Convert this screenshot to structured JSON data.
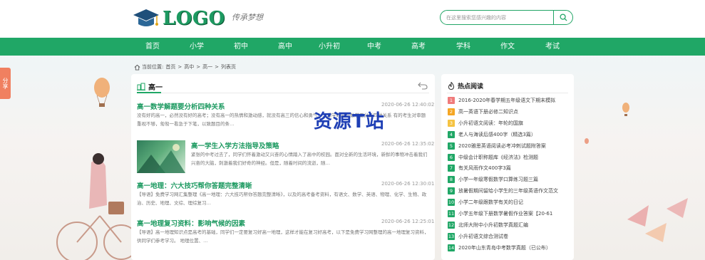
{
  "header": {
    "logo_text": "LOGO",
    "slogan": "传承梦想",
    "search_placeholder": "在这里搜索您感兴趣的内容"
  },
  "nav": {
    "items": [
      "首页",
      "小学",
      "初中",
      "高中",
      "小升初",
      "中考",
      "高考",
      "学科",
      "作文",
      "考试"
    ]
  },
  "share_tab": "分享",
  "breadcrumb": {
    "prefix": "当前位置:",
    "items": [
      "首页",
      ">",
      "高中",
      ">",
      "高一",
      ">",
      "列表页"
    ]
  },
  "main": {
    "section_title": "高一",
    "articles": [
      {
        "title": "高一数学解题要分析四种关系",
        "date": "2020-06-26 12:40:02",
        "desc": "没有好的高一，必然没有好的高考；没有高一的热情和激动感，就没有高三的信心和勇气……想学好高一数学要分析四种关系    有的考生对审题重视不够，匆匆一看急于下笔，以致题目的条…"
      },
      {
        "title": "高一学生入学方法指导及策略",
        "date": "2020-06-26 12:35:02",
        "desc": "紧张的中考过去了，同学们怀着激动又兴奋的心情踏入了高中的校园。面对全新的生活环境，新鲜的事物冲击着我们兴奋的大脑，刺激着我们好奇的神经。但是，随着时间的流逝，随…"
      },
      {
        "title": "高一地理：六大技巧帮你答题完整清晰",
        "date": "2020-06-26 12:30:01",
        "desc": "【导语】免费学习网汇集整理《高一地理：六大技巧帮你答题完整清晰》，以及的高考备考资料，有语文、数学、英语、物理、化学、生物、政治、历史、地理、文综、理综复习…"
      },
      {
        "title": "高一地理复习资料：影响气候的因素",
        "date": "2020-06-26 12:25:01",
        "desc": "【导语】高一地理知识点是高考的基础，同学们一定要复习好高一地理，这样才能在复习好高考，以下是免费学习网整理的高一地理复习资料，供同学们参考学习。    地理位置、…"
      }
    ]
  },
  "sidebar": {
    "title": "热点阅读",
    "items": [
      {
        "num": "1",
        "text": "2016-2020年春学期五年级语文下期末模拟",
        "color": "#f07b7b"
      },
      {
        "num": "2",
        "text": "高一英语下册必修二知识点",
        "color": "#f5a623"
      },
      {
        "num": "3",
        "text": "小升初语文阅读：年轮的国旗",
        "color": "#f5c342"
      },
      {
        "num": "4",
        "text": "老人与海读后感400字（精选3篇）",
        "color": "#20a766"
      },
      {
        "num": "5",
        "text": "2020雅思英语阅读必考冲刺试题附答案",
        "color": "#20a766"
      },
      {
        "num": "6",
        "text": "中级会计职称题库《经济法》检测题",
        "color": "#20a766"
      },
      {
        "num": "7",
        "text": "有关风雨作文400字3篇",
        "color": "#20a766"
      },
      {
        "num": "8",
        "text": "小学一年级寒假数学口算练习题三篇",
        "color": "#20a766"
      },
      {
        "num": "9",
        "text": "放暑假期间留给小学生的三年级英语作文范文",
        "color": "#20a766"
      },
      {
        "num": "10",
        "text": "小学二年级跟数学有关的日记",
        "color": "#20a766"
      },
      {
        "num": "11",
        "text": "小学五年级下册数学暑假作业答案【20-61",
        "color": "#20a766"
      },
      {
        "num": "12",
        "text": "北师大附中小升初数学真题汇编",
        "color": "#20a766"
      },
      {
        "num": "13",
        "text": "小升初语文综合测试卷",
        "color": "#20a766"
      },
      {
        "num": "14",
        "text": "2020年山东青岛中考数学真题（已公布）",
        "color": "#20a766"
      }
    ]
  },
  "watermark": "资源T站",
  "colors": {
    "brand_green": "#20a766",
    "title_green": "#1d9a61",
    "watermark_blue": "#1f3fb5"
  }
}
